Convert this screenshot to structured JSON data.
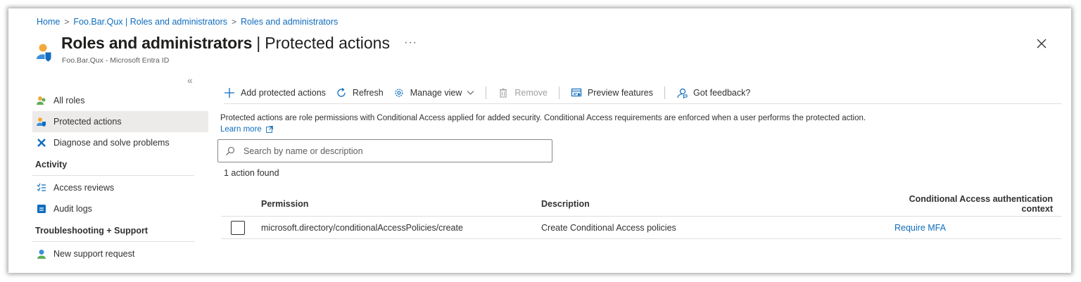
{
  "breadcrumb": {
    "items": [
      "Home",
      "Foo.Bar.Qux | Roles and administrators",
      "Roles and administrators"
    ]
  },
  "header": {
    "title_main": "Roles and administrators",
    "title_separator": "|",
    "title_sub": "Protected actions",
    "more": "···",
    "subtitle": "Foo.Bar.Qux - Microsoft Entra ID",
    "close_icon": "close-icon"
  },
  "sidebar": {
    "collapse": "«",
    "items": [
      {
        "label": "All roles",
        "icon": "roles-icon"
      },
      {
        "label": "Protected actions",
        "icon": "protected-actions-icon",
        "active": true
      },
      {
        "label": "Diagnose and solve problems",
        "icon": "wrench-icon"
      }
    ],
    "groups": [
      {
        "title": "Activity",
        "items": [
          {
            "label": "Access reviews",
            "icon": "checklist-icon"
          },
          {
            "label": "Audit logs",
            "icon": "audit-log-icon"
          }
        ]
      },
      {
        "title": "Troubleshooting + Support",
        "items": [
          {
            "label": "New support request",
            "icon": "support-icon"
          }
        ]
      }
    ]
  },
  "toolbar": {
    "add": "Add protected actions",
    "refresh": "Refresh",
    "manage_view": "Manage view",
    "remove": "Remove",
    "preview": "Preview features",
    "feedback": "Got feedback?"
  },
  "content": {
    "description": "Protected actions are role permissions with Conditional Access applied for added security. Conditional Access requirements are enforced when a user performs the protected action.",
    "learn_more": "Learn more",
    "search_placeholder": "Search by name or description",
    "count": "1 action found"
  },
  "table": {
    "headers": {
      "permission": "Permission",
      "description": "Description",
      "context": "Conditional Access authentication context"
    },
    "rows": [
      {
        "permission": "microsoft.directory/conditionalAccessPolicies/create",
        "description": "Create Conditional Access policies",
        "context": "Require MFA"
      }
    ]
  },
  "colors": {
    "link": "#0f6cbd",
    "active_bg": "#edebe9",
    "text": "#323130"
  }
}
